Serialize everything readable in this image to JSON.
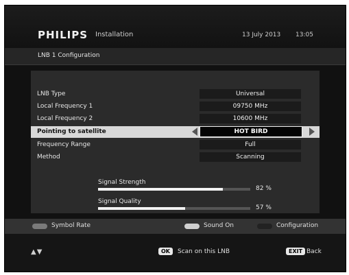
{
  "header": {
    "brand": "PHILIPS",
    "title": "Installation",
    "date": "13 July 2013",
    "time": "13:05"
  },
  "subheader": {
    "title": "LNB 1 Configuration"
  },
  "settings": [
    {
      "label": "LNB Type",
      "value": "Universal"
    },
    {
      "label": "Local Frequency 1",
      "value": "09750 MHz"
    },
    {
      "label": "Local Frequency 2",
      "value": "10600 MHz"
    },
    {
      "label": "Pointing to satellite",
      "value": "HOT BIRD",
      "selected": true
    },
    {
      "label": "Frequency Range",
      "value": "Full"
    },
    {
      "label": "Method",
      "value": "Scanning"
    }
  ],
  "signal": {
    "strength": {
      "label": "Signal Strength",
      "percent_text": "82 %",
      "level": 0.82
    },
    "quality": {
      "label": "Signal Quality",
      "percent_text": "57 %",
      "level": 0.57
    }
  },
  "keybar": {
    "red": {
      "label": "Symbol Rate",
      "color": "#7a7a7a"
    },
    "green": {
      "label": "Sound On",
      "color": "#d0d0d0"
    },
    "blue": {
      "label": "Configuration",
      "color": "#222222"
    }
  },
  "footer": {
    "nav_arrows": "▲▼",
    "ok_key": "OK",
    "ok_label": "Scan on this LNB",
    "exit_key": "EXIT",
    "exit_label": "Back"
  },
  "icons": {
    "left_arrow": "left-triangle-icon",
    "right_arrow": "right-triangle-icon",
    "nav": "up-down-arrows-icon"
  }
}
